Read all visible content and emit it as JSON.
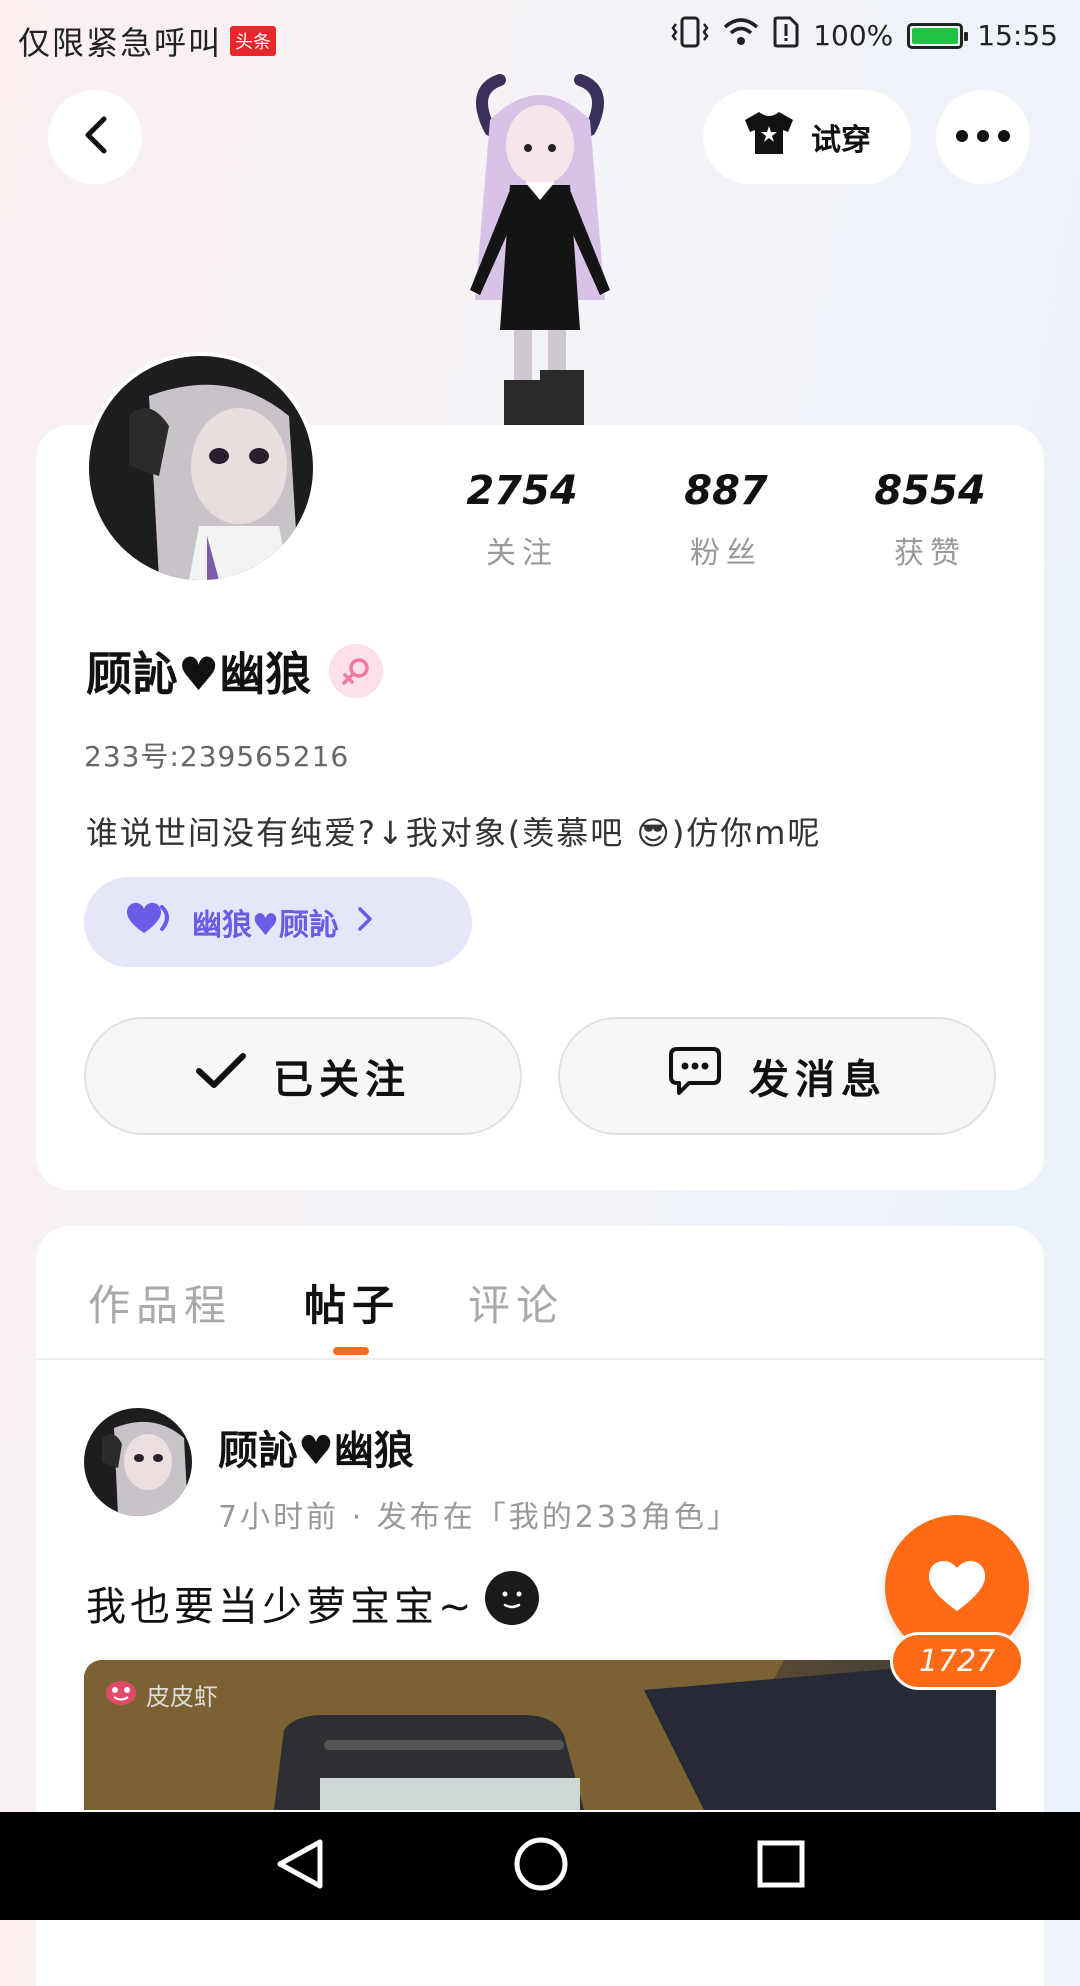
{
  "status_bar": {
    "carrier_text": "仅限紧急呼叫",
    "badge": "头条",
    "battery_text": "100%",
    "battery_level": 1.0,
    "time": "15:55"
  },
  "header": {
    "try_on_label": "试穿"
  },
  "stats": [
    {
      "value": "2754",
      "label": "关注"
    },
    {
      "value": "887",
      "label": "粉丝"
    },
    {
      "value": "8554",
      "label": "获赞"
    }
  ],
  "profile": {
    "name": "顾訫♥幽狼",
    "id_text": "233号:239565216",
    "bio": "谁说世间没有纯爱?↓我对象(羡慕吧 😎)仿你m呢",
    "couple_chip": "幽狼♥顾訫",
    "follow_label": "已关注",
    "message_label": "发消息"
  },
  "tabs": [
    {
      "label": "作品程",
      "active": false
    },
    {
      "label": "帖子",
      "active": true
    },
    {
      "label": "评论",
      "active": false
    }
  ],
  "post": {
    "author": "顾訫♥幽狼",
    "meta": "7小时前 · 发布在「我的233角色」",
    "text": "我也要当少萝宝宝~",
    "watermark": "皮皮虾"
  },
  "like": {
    "count": "1727"
  },
  "colors": {
    "accent_orange": "#ff6b14",
    "chip_purple": "#6a5ce6",
    "battery_green": "#22c244"
  },
  "icons": [
    "back-icon",
    "shirt-icon",
    "more-icon",
    "female-icon",
    "heart-couple-icon",
    "check-icon",
    "chat-icon",
    "heart-icon",
    "nav-back-icon",
    "nav-home-icon",
    "nav-recent-icon"
  ]
}
